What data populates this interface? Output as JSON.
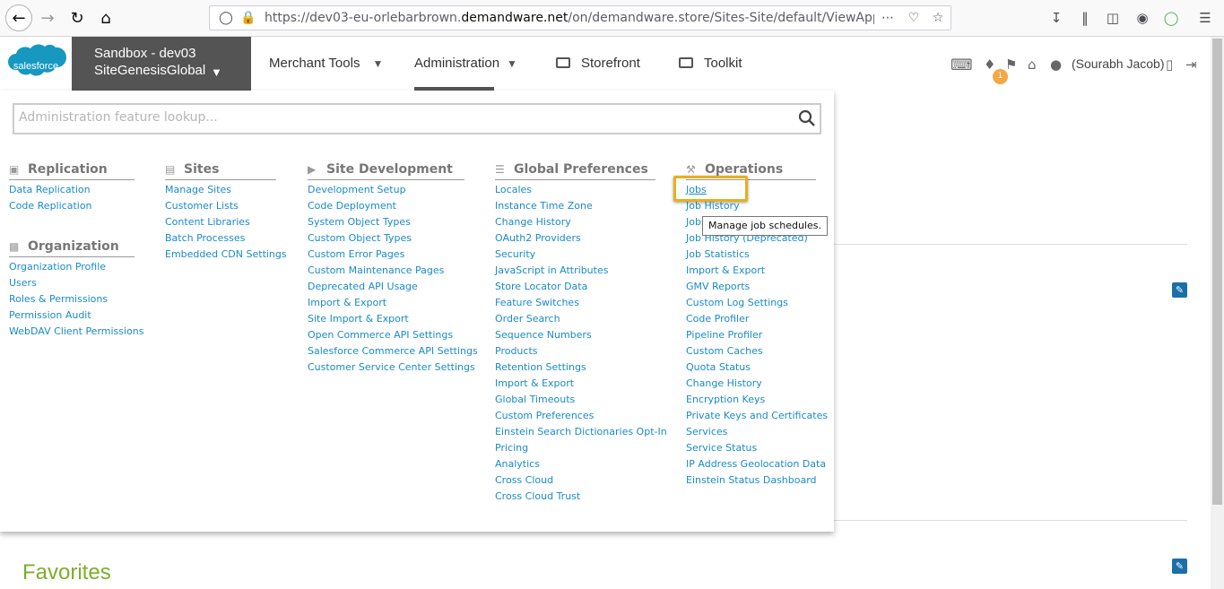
{
  "browser": {
    "url_prefix": "https://dev03-eu-orlebarbrown.",
    "url_domain": "demandware.net",
    "url_suffix": "/on/demandware.store/Sites-Site/default/ViewApplication-Disp",
    "icons": [
      "back-icon",
      "forward-icon",
      "reload-icon",
      "home-icon",
      "shield-icon",
      "lock-icon",
      "more-icon",
      "pocket-icon",
      "star-icon",
      "download-icon",
      "library-icon",
      "sidebar-icon",
      "account-icon",
      "extension-icon",
      "menu-icon"
    ]
  },
  "header": {
    "logo_text": "salesforce",
    "site_line1": "Sandbox - dev03",
    "site_line2": "SiteGenesisGlobal",
    "menu": {
      "merchant_tools": "Merchant Tools",
      "administration": "Administration",
      "storefront": "Storefront",
      "toolkit": "Toolkit"
    },
    "notification_count": "1",
    "user_name": "(Sourabh Jacob)"
  },
  "admin": {
    "lookup_placeholder": "Administration feature lookup...",
    "replication": {
      "title": "Replication",
      "links": [
        "Data Replication",
        "Code Replication"
      ]
    },
    "organization": {
      "title": "Organization",
      "links": [
        "Organization Profile",
        "Users",
        "Roles & Permissions",
        "Permission Audit",
        "WebDAV Client Permissions"
      ]
    },
    "sites": {
      "title": "Sites",
      "links": [
        "Manage Sites",
        "Customer Lists",
        "Content Libraries",
        "Batch Processes",
        "Embedded CDN Settings"
      ]
    },
    "site_development": {
      "title": "Site Development",
      "links": [
        "Development Setup",
        "Code Deployment",
        "System Object Types",
        "Custom Object Types",
        "Custom Error Pages",
        "Custom Maintenance Pages",
        "Deprecated API Usage",
        "Import & Export",
        "Site Import & Export",
        "Open Commerce API Settings",
        "Salesforce Commerce API Settings",
        "Customer Service Center Settings"
      ]
    },
    "global_preferences": {
      "title": "Global Preferences",
      "links": [
        "Locales",
        "Instance Time Zone",
        "Change History",
        "OAuth2 Providers",
        "Security",
        "JavaScript in Attributes",
        "Store Locator Data",
        "Feature Switches",
        "Order Search",
        "Sequence Numbers",
        "Products",
        "Retention Settings",
        "Import & Export",
        "Global Timeouts",
        "Custom Preferences",
        "Einstein Search Dictionaries Opt-In",
        "Pricing",
        "Analytics",
        "Cross Cloud",
        "Cross Cloud Trust"
      ]
    },
    "operations": {
      "title": "Operations",
      "links": [
        "Jobs",
        "Job History",
        "Jobs",
        "Job History (Deprecated)",
        "Job Statistics",
        "Import & Export",
        "GMV Reports",
        "Custom Log Settings",
        "Code Profiler",
        "Pipeline Profiler",
        "Custom Caches",
        "Quota Status",
        "Change History",
        "Encryption Keys",
        "Private Keys and Certificates",
        "Services",
        "Service Status",
        "IP Address Geolocation Data",
        "Einstein Status Dashboard"
      ]
    },
    "tooltip": "Manage job schedules."
  },
  "page": {
    "favorites_title": "Favorites"
  },
  "colors": {
    "link": "#1a8bc8",
    "site_select_bg": "#545454",
    "highlight": "#e5b11c",
    "favorites": "#7bb02a"
  }
}
